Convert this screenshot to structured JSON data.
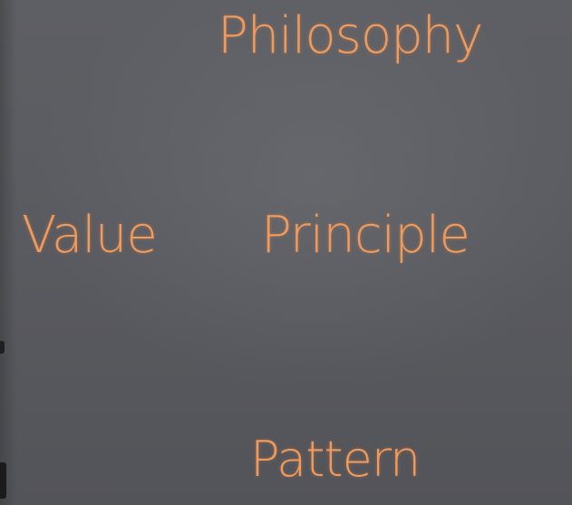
{
  "slide": {
    "words": {
      "philosophy": "Philosophy",
      "value": "Value",
      "principle": "Principle",
      "pattern": "Pattern"
    }
  },
  "colors": {
    "text": "#f09a5c",
    "background": "#5a5b60"
  }
}
